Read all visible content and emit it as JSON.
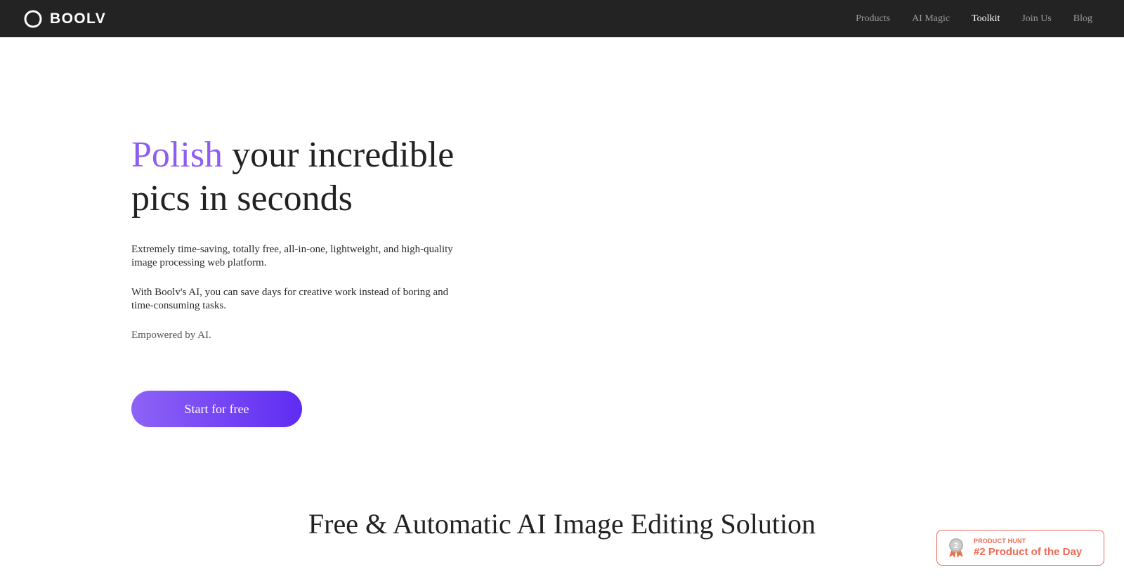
{
  "brand": {
    "name": "BOOLV"
  },
  "nav": {
    "items": [
      {
        "label": "Products"
      },
      {
        "label": "AI Magic"
      },
      {
        "label": "Toolkit"
      },
      {
        "label": "Join Us"
      },
      {
        "label": "Blog"
      }
    ],
    "active": "Toolkit"
  },
  "hero": {
    "title_accent": "Polish",
    "title_rest": " your incredible pics in seconds",
    "paragraph1": "Extremely time-saving, totally free, all-in-one, lightweight, and high-quality image processing web platform.",
    "paragraph2": "With Boolv's AI, you can save days for creative work instead of boring and time-consuming tasks.",
    "paragraph3": "Empowered by AI.",
    "cta_label": "Start for free"
  },
  "section": {
    "title": "Free & Automatic AI Image Editing Solution"
  },
  "product_hunt": {
    "label": "PRODUCT HUNT",
    "rank_text": "#2 Product of the Day",
    "medal_number": "2"
  },
  "colors": {
    "nav_bg": "#232323",
    "accent_purple": "#8e5cf2",
    "cta_gradient_start": "#8e63f6",
    "cta_gradient_end": "#5f2cf2",
    "product_hunt_red": "#ef6a55"
  },
  "icons": {
    "logo": "boolv-logo-icon",
    "medal": "medal-icon"
  }
}
